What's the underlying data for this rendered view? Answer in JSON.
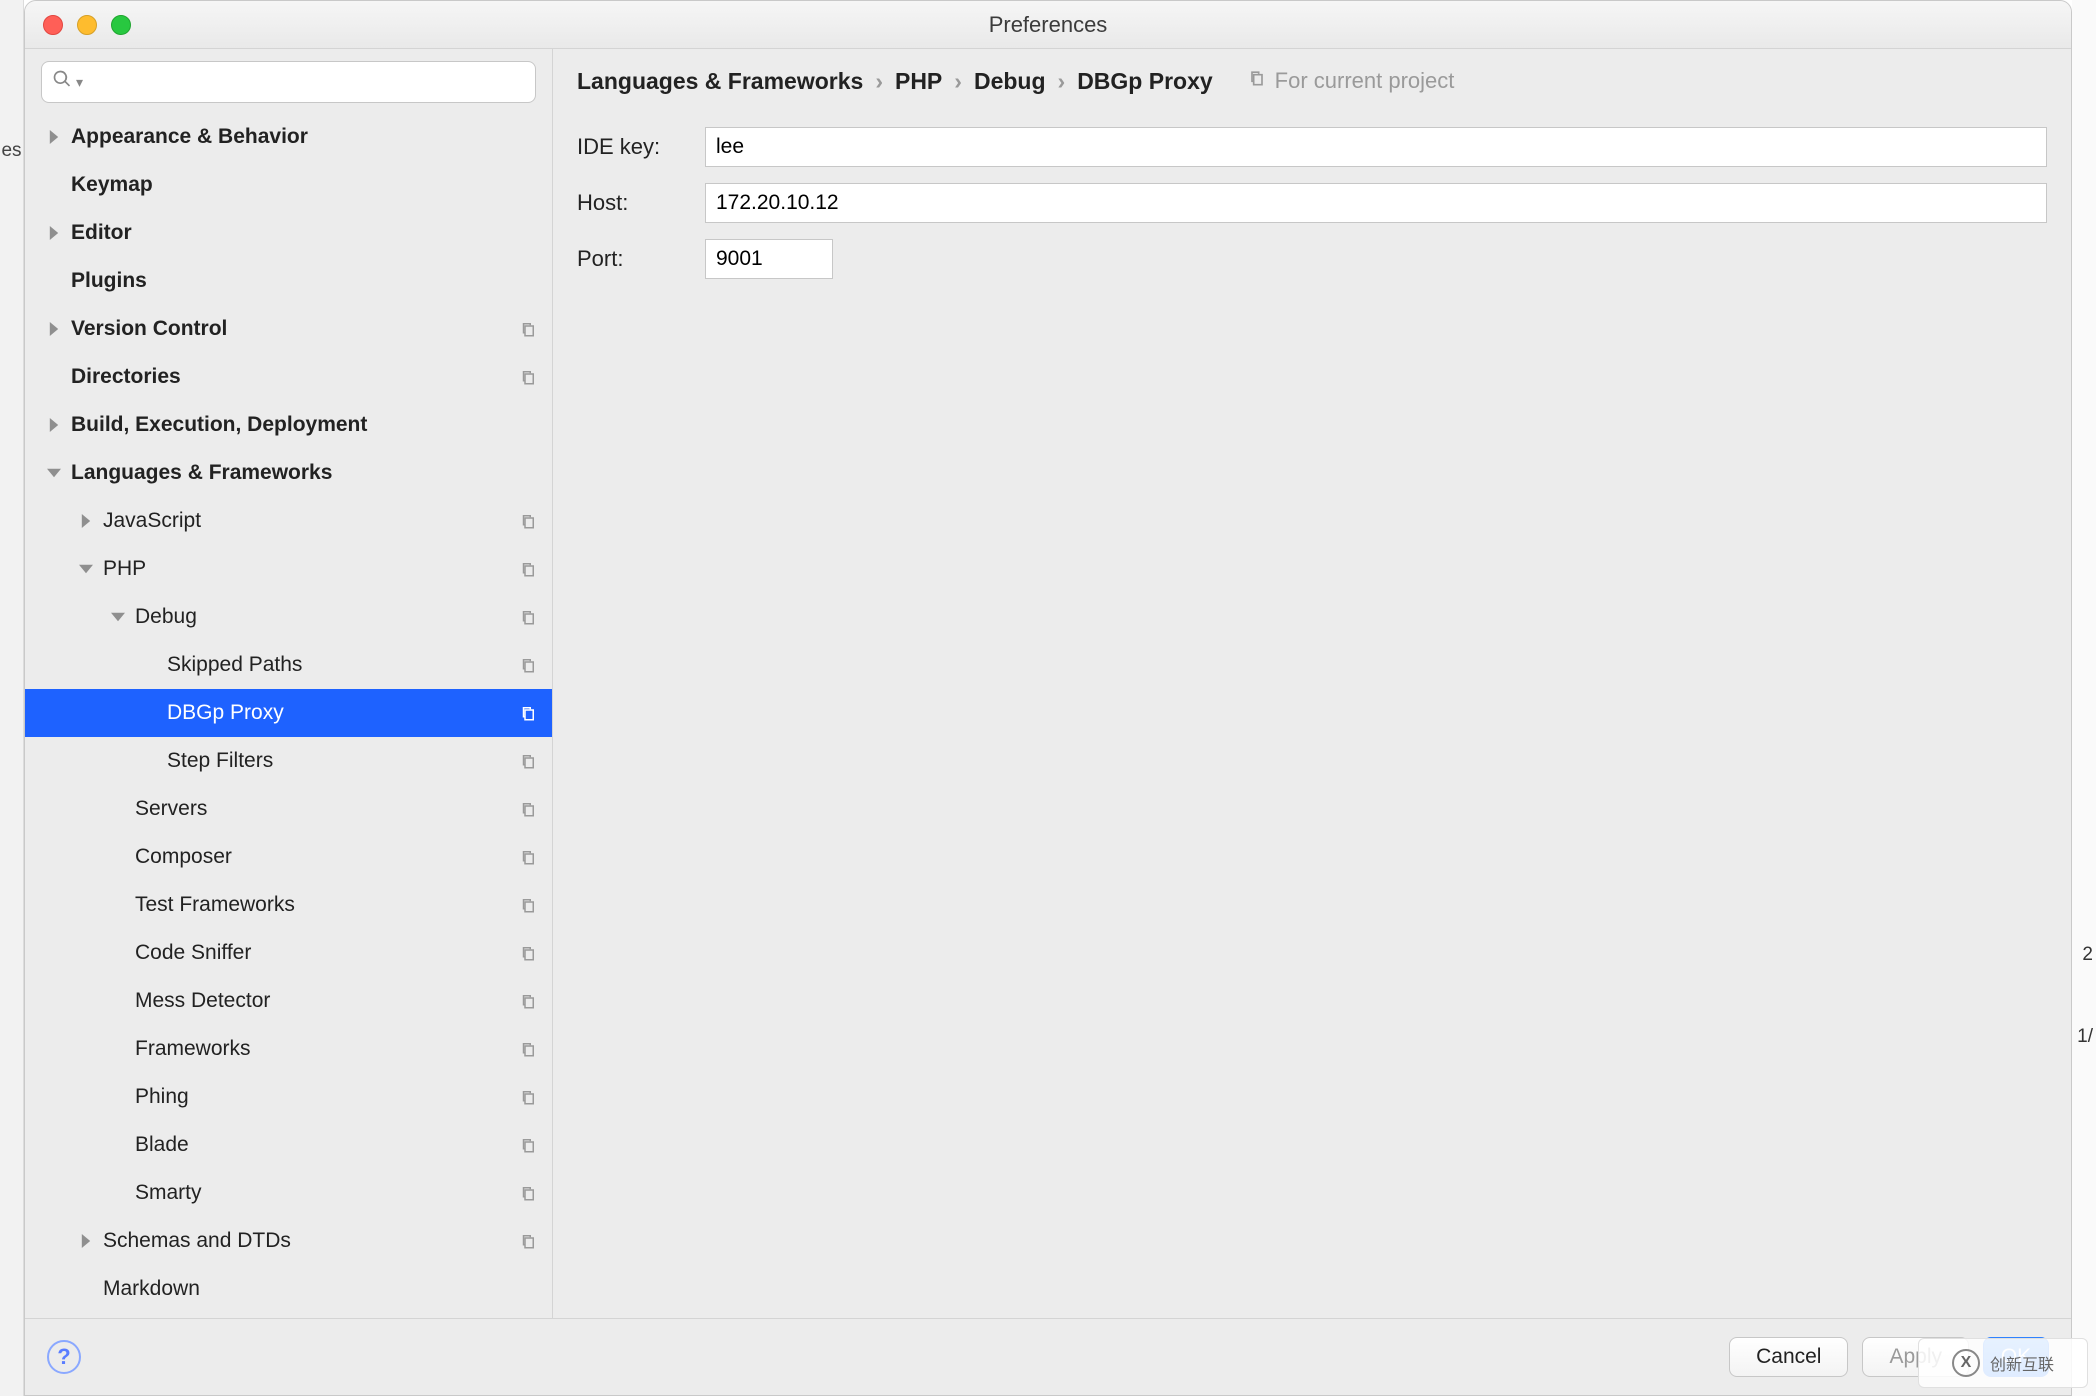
{
  "window": {
    "title": "Preferences"
  },
  "search": {
    "placeholder": ""
  },
  "sidebar": {
    "items": [
      {
        "label": "Appearance & Behavior",
        "indent": 0,
        "arrow": "right",
        "bold": true,
        "copy": false
      },
      {
        "label": "Keymap",
        "indent": 0,
        "arrow": "none",
        "bold": true,
        "copy": false
      },
      {
        "label": "Editor",
        "indent": 0,
        "arrow": "right",
        "bold": true,
        "copy": false
      },
      {
        "label": "Plugins",
        "indent": 0,
        "arrow": "none",
        "bold": true,
        "copy": false
      },
      {
        "label": "Version Control",
        "indent": 0,
        "arrow": "right",
        "bold": true,
        "copy": true
      },
      {
        "label": "Directories",
        "indent": 0,
        "arrow": "none",
        "bold": true,
        "copy": true
      },
      {
        "label": "Build, Execution, Deployment",
        "indent": 0,
        "arrow": "right",
        "bold": true,
        "copy": false
      },
      {
        "label": "Languages & Frameworks",
        "indent": 0,
        "arrow": "down",
        "bold": true,
        "copy": false
      },
      {
        "label": "JavaScript",
        "indent": 1,
        "arrow": "right",
        "bold": false,
        "copy": true
      },
      {
        "label": "PHP",
        "indent": 1,
        "arrow": "down",
        "bold": false,
        "copy": true
      },
      {
        "label": "Debug",
        "indent": 2,
        "arrow": "down",
        "bold": false,
        "copy": true
      },
      {
        "label": "Skipped Paths",
        "indent": 3,
        "arrow": "none",
        "bold": false,
        "copy": true
      },
      {
        "label": "DBGp Proxy",
        "indent": 3,
        "arrow": "none",
        "bold": false,
        "copy": true,
        "selected": true
      },
      {
        "label": "Step Filters",
        "indent": 3,
        "arrow": "none",
        "bold": false,
        "copy": true
      },
      {
        "label": "Servers",
        "indent": 2,
        "arrow": "none",
        "bold": false,
        "copy": true
      },
      {
        "label": "Composer",
        "indent": 2,
        "arrow": "none",
        "bold": false,
        "copy": true
      },
      {
        "label": "Test Frameworks",
        "indent": 2,
        "arrow": "none",
        "bold": false,
        "copy": true
      },
      {
        "label": "Code Sniffer",
        "indent": 2,
        "arrow": "none",
        "bold": false,
        "copy": true
      },
      {
        "label": "Mess Detector",
        "indent": 2,
        "arrow": "none",
        "bold": false,
        "copy": true
      },
      {
        "label": "Frameworks",
        "indent": 2,
        "arrow": "none",
        "bold": false,
        "copy": true
      },
      {
        "label": "Phing",
        "indent": 2,
        "arrow": "none",
        "bold": false,
        "copy": true
      },
      {
        "label": "Blade",
        "indent": 2,
        "arrow": "none",
        "bold": false,
        "copy": true
      },
      {
        "label": "Smarty",
        "indent": 2,
        "arrow": "none",
        "bold": false,
        "copy": true
      },
      {
        "label": "Schemas and DTDs",
        "indent": 1,
        "arrow": "right",
        "bold": false,
        "copy": true
      },
      {
        "label": "Markdown",
        "indent": 1,
        "arrow": "none",
        "bold": false,
        "copy": false
      }
    ]
  },
  "breadcrumb": {
    "parts": [
      "Languages & Frameworks",
      "PHP",
      "Debug",
      "DBGp Proxy"
    ],
    "sep": "›",
    "note": "For current project"
  },
  "form": {
    "ide_key": {
      "label": "IDE key:",
      "value": "lee"
    },
    "host": {
      "label": "Host:",
      "value": "172.20.10.12"
    },
    "port": {
      "label": "Port:",
      "value": "9001"
    }
  },
  "footer": {
    "cancel": "Cancel",
    "apply": "Apply",
    "ok": "OK",
    "help": "?"
  },
  "bg": {
    "left": "es",
    "right_top": "2",
    "right_bottom": "1/"
  },
  "watermark": {
    "text": "创新互联",
    "mark": "X"
  }
}
